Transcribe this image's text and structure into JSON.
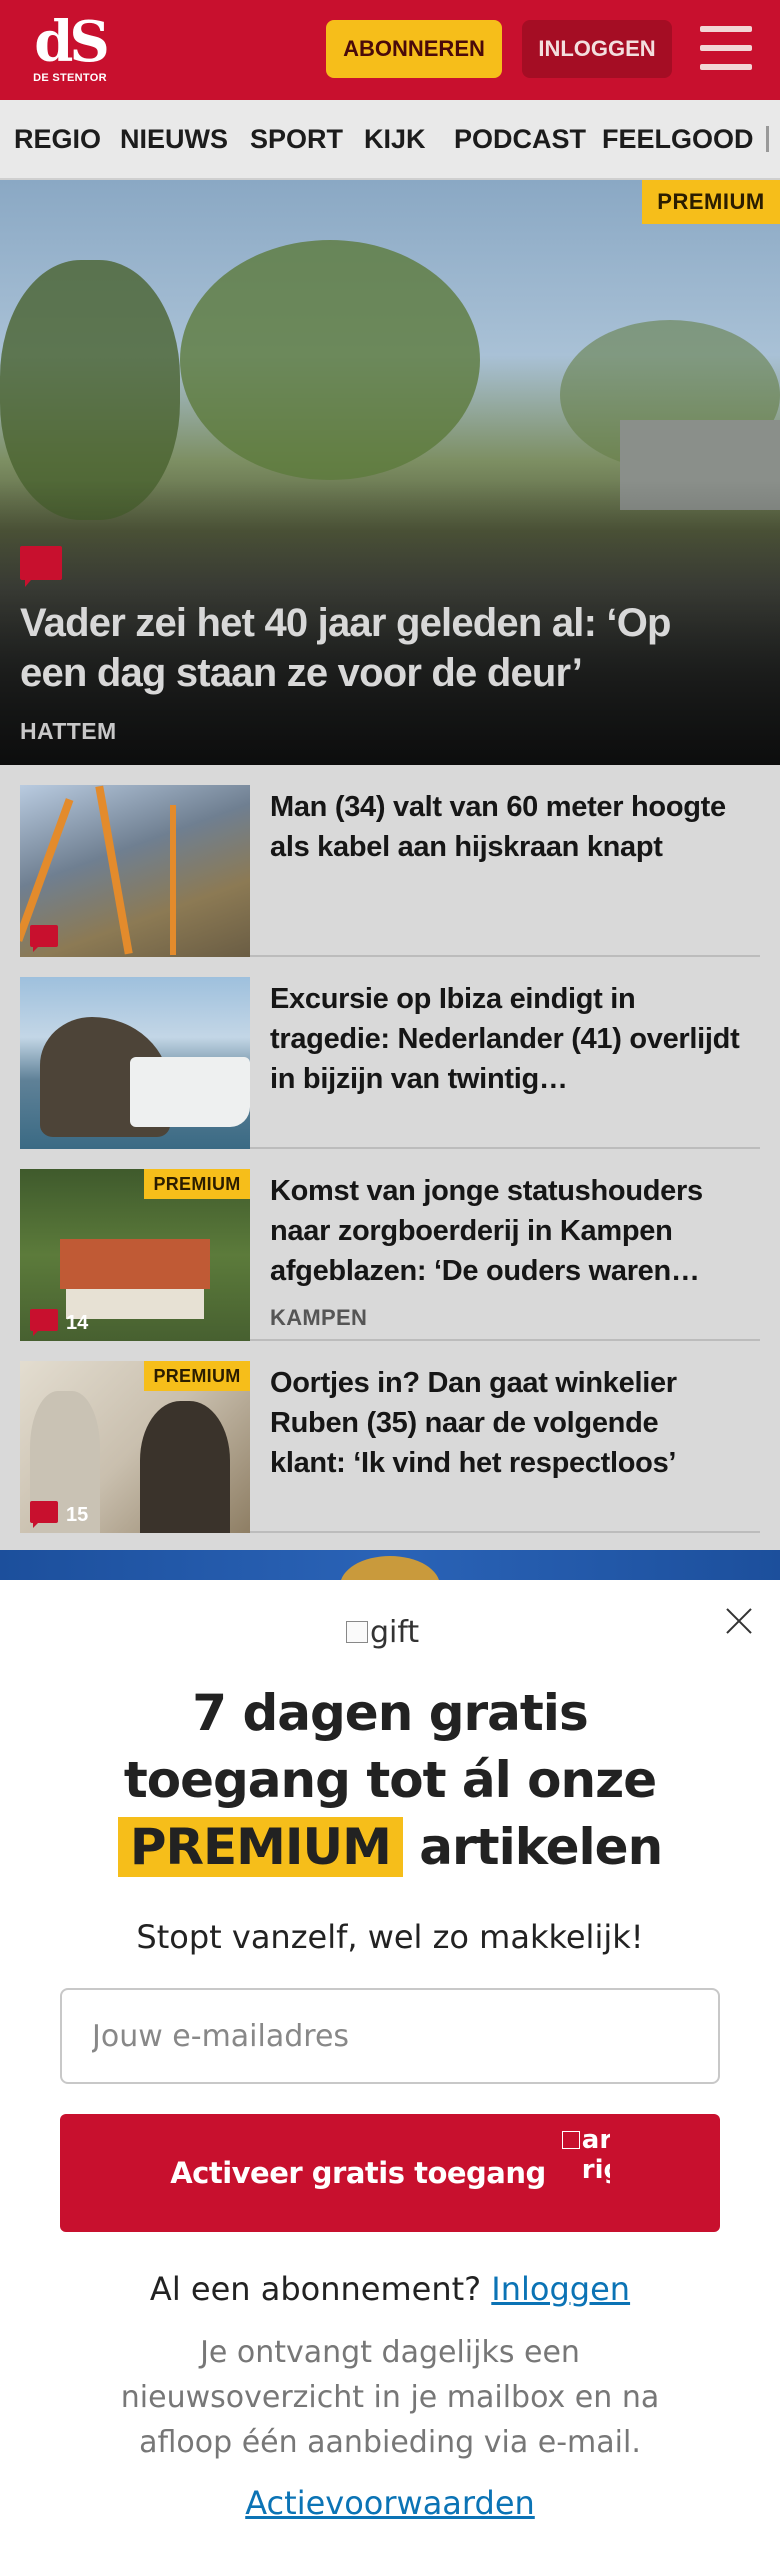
{
  "header": {
    "logo_mark": "dS",
    "logo_sub": "DE STENTOR",
    "subscribe_label": "ABONNEREN",
    "login_label": "INLOGGEN"
  },
  "nav": {
    "items": [
      "REGIO",
      "NIEUWS",
      "SPORT",
      "KIJK",
      "PODCAST",
      "FEELGOOD"
    ]
  },
  "hero": {
    "badge": "PREMIUM",
    "title": "Vader zei het 40 jaar geleden al: ‘Op een dag staan ze voor de deur’",
    "location": "HATTEM",
    "has_comments": true
  },
  "articles": [
    {
      "title": "Man (34) valt van 60 meter hoogte als kabel aan hijskraan knapt",
      "premium": false,
      "comment_count": "",
      "location": ""
    },
    {
      "title": "Excursie op Ibiza eindigt in tragedie: Nederlander (41) overlijdt in bijzijn van twintig…",
      "premium": false,
      "comment_count": "",
      "location": ""
    },
    {
      "title": "Komst van jonge statushouders naar zorgboerderij in Kampen afgeblazen: ‘De ouders waren…",
      "premium": true,
      "badge": "PREMIUM",
      "comment_count": "14",
      "location": "KAMPEN"
    },
    {
      "title": "Oortjes in? Dan gaat winkelier Ruben (35) naar de volgende klant: ‘Ik vind het respectloos’",
      "premium": true,
      "badge": "PREMIUM",
      "comment_count": "15",
      "location": ""
    }
  ],
  "modal": {
    "gift_alt": "gift",
    "headline_line1": "7 dagen gratis",
    "headline_line2": "toegang tot ál onze",
    "headline_premium": "PREMIUM",
    "headline_tail": "artikelen",
    "subline": "Stopt vanzelf, wel zo makkelijk!",
    "email_placeholder": "Jouw e-mailadres",
    "email_value": "",
    "cta_label": "Activeer gratis toegang",
    "cta_icon_alt": "arrow-right",
    "login_prompt": "Al een abonnement?",
    "login_link": "Inloggen",
    "note": "Je ontvangt dagelijks een nieuwsoverzicht in je mailbox en na afloop één aanbieding via e-mail.",
    "terms_link": "Actievoorwaarden"
  },
  "colors": {
    "brand_red": "#c8102e",
    "premium_yellow": "#f6be1a",
    "link_blue": "#0b73b5"
  },
  "icons": {
    "menu": "hamburger-icon",
    "comment": "comment-icon",
    "close": "close-icon",
    "gift": "gift-icon",
    "arrow": "arrow-right-icon"
  }
}
